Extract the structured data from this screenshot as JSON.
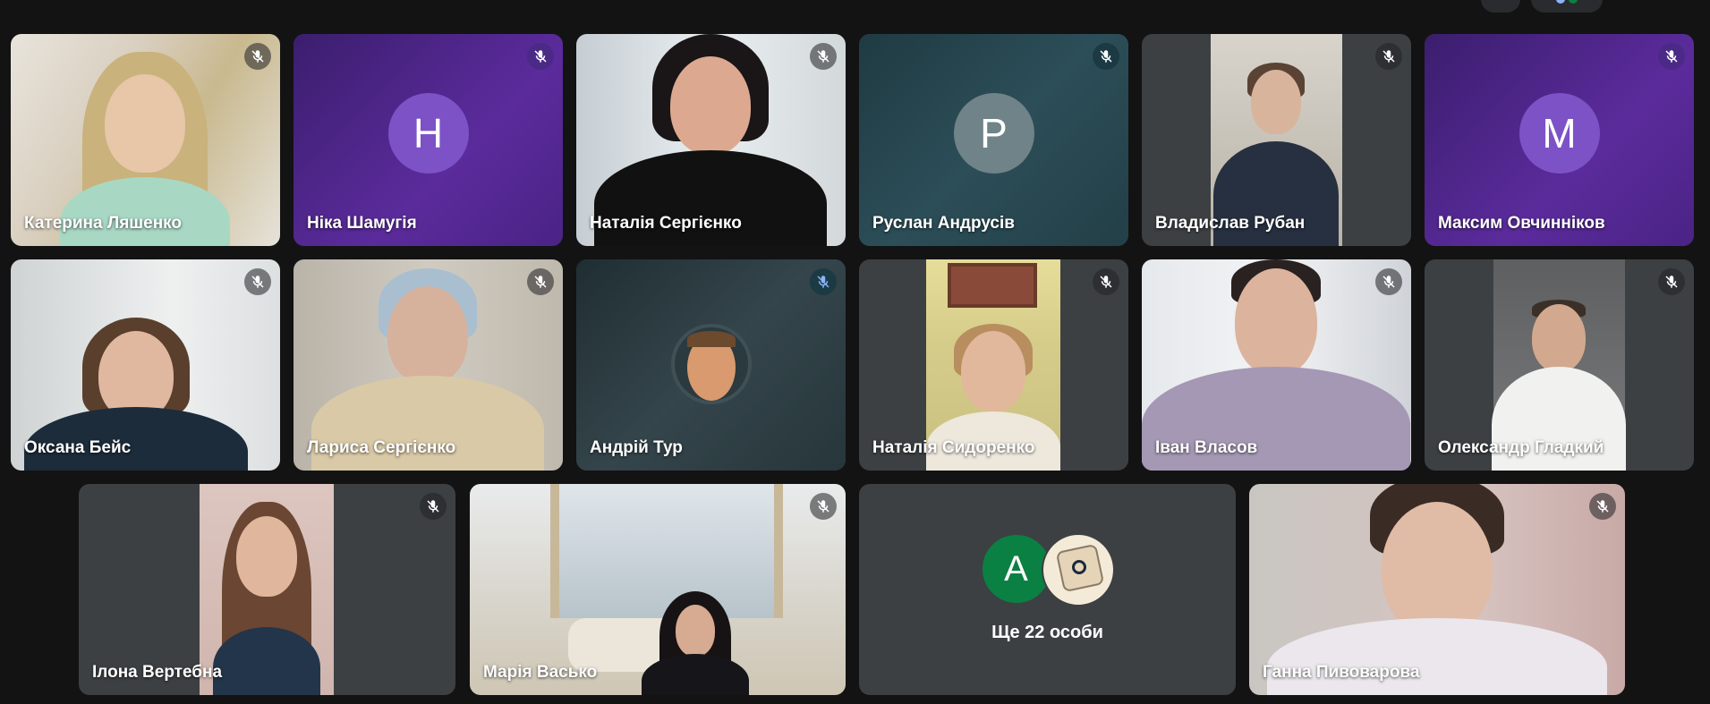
{
  "participants": [
    {
      "name": "Катерина Ляшенко",
      "type": "video",
      "muted": true
    },
    {
      "name": "Ніка Шамугія",
      "type": "avatar",
      "initial": "Н",
      "muted": true
    },
    {
      "name": "Наталія Сергієнко",
      "type": "video",
      "muted": true
    },
    {
      "name": "Руслан Андрусів",
      "type": "avatar",
      "initial": "Р",
      "muted": true
    },
    {
      "name": "Владислав Рубан",
      "type": "video",
      "muted": true
    },
    {
      "name": "Максим Овчинніков",
      "type": "avatar",
      "initial": "М",
      "muted": true
    },
    {
      "name": "Оксана Бейс",
      "type": "video",
      "muted": true
    },
    {
      "name": "Лариса Сергієнко",
      "type": "video",
      "muted": true
    },
    {
      "name": "Андрій Тур",
      "type": "profile-photo",
      "muted": true
    },
    {
      "name": "Наталія Сидоренко",
      "type": "video",
      "muted": true
    },
    {
      "name": "Іван Власов",
      "type": "video",
      "muted": true
    },
    {
      "name": "Олександр Гладкий",
      "type": "video",
      "muted": true
    },
    {
      "name": "Ілона Вертебна",
      "type": "video",
      "muted": true
    },
    {
      "name": "Марія Васько",
      "type": "video",
      "muted": true
    },
    {
      "name": "Ганна Пивоварова",
      "type": "video",
      "muted": true
    }
  ],
  "overflow": {
    "label": "Ще 22 особи",
    "avatar_initial": "А"
  },
  "icons": {
    "mic": "mic-off-icon"
  },
  "colors": {
    "background": "#131314",
    "tile": "#3c4043",
    "purple": "#5b2b9c",
    "teal": "#2c4e58",
    "overflow_avatar": "#0b8043"
  }
}
